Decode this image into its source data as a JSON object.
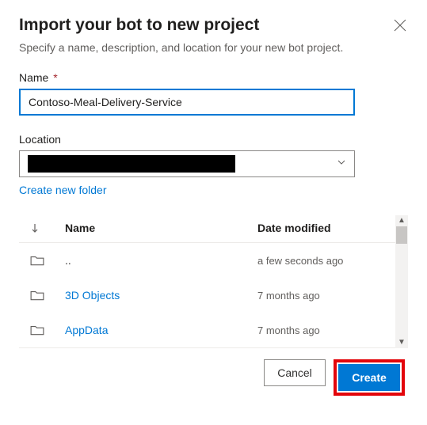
{
  "dialog": {
    "title": "Import your bot to new project",
    "subtitle": "Specify a name, description, and location for your new bot project."
  },
  "fields": {
    "name_label": "Name",
    "name_required": "*",
    "name_value": "Contoso-Meal-Delivery-Service",
    "location_label": "Location",
    "create_folder_link": "Create new folder"
  },
  "browser": {
    "columns": {
      "name": "Name",
      "date": "Date modified"
    },
    "rows": [
      {
        "name": "..",
        "date": "a few seconds ago",
        "kind": "parent"
      },
      {
        "name": "3D Objects",
        "date": "7 months ago",
        "kind": "folder"
      },
      {
        "name": "AppData",
        "date": "7 months ago",
        "kind": "folder"
      }
    ]
  },
  "buttons": {
    "cancel": "Cancel",
    "create": "Create"
  }
}
